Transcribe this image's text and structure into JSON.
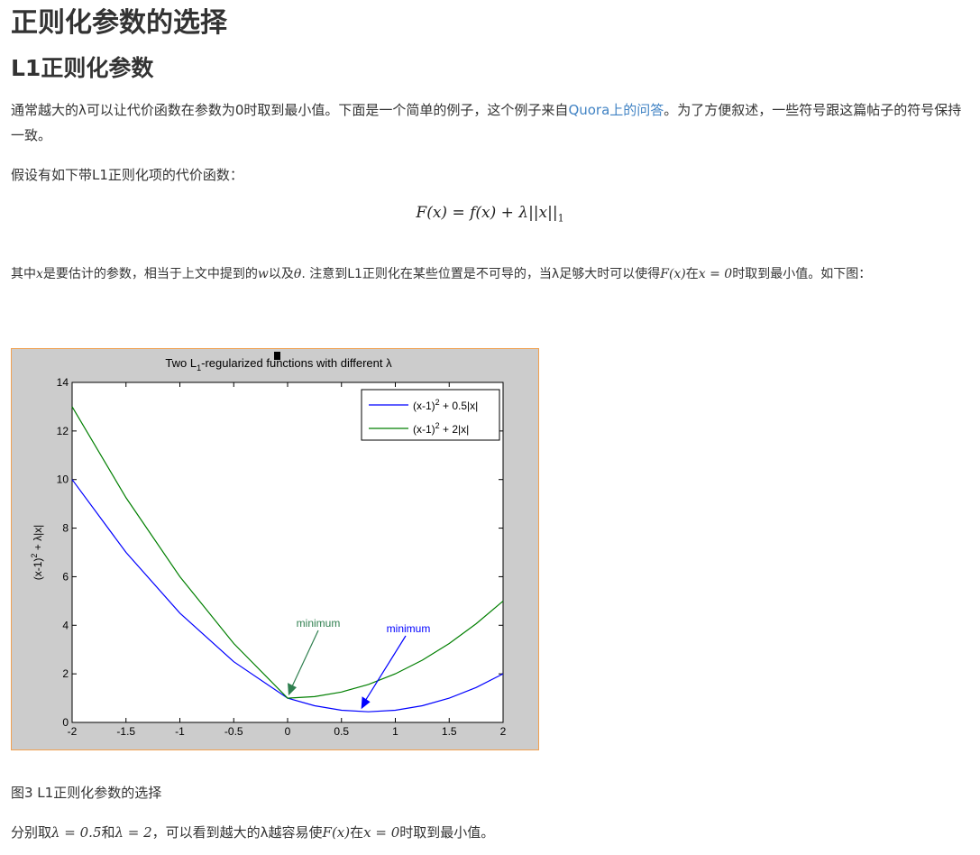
{
  "title": "正则化参数的选择",
  "subtitle": "L1正则化参数",
  "para1": {
    "pre": "通常越大的λ可以让代价函数在参数为0时取到最小值。下面是一个简单的例子，这个例子来自",
    "link": "Quora上的问答",
    "post": "。为了方便叙述，一些符号跟这篇帖子的符号保持一致。"
  },
  "para2": "假设有如下带L1正则化项的代价函数：",
  "formula": {
    "lhs": "F(x) = f(x) + λ||x||",
    "sub": "1"
  },
  "para3": {
    "t1": "其中",
    "v1": "x",
    "t2": "是要估计的参数，相当于上文中提到的",
    "v2": "w",
    "t3": "以及",
    "v3": "θ",
    "t4": ". 注意到L1正则化在某些位置是不可导的，当λ足够大时可以使得",
    "v4": "F(x)",
    "t5": "在",
    "v5": "x = 0",
    "t6": "时取到最小值。如下图："
  },
  "caption": "图3 L1正则化参数的选择",
  "last": {
    "t1": "分别取",
    "v1": "λ = 0.5",
    "t2": "和",
    "v2": "λ = 2",
    "t3": "，可以看到越大的λ越容易使",
    "v3": "F(x)",
    "t4": "在",
    "v4": "x = 0",
    "t5": "时取到最小值。"
  },
  "chart_data": {
    "type": "line",
    "title": "Two L1-regularized functions with different λ",
    "ylabel": "(x-1)2 + λ|x|",
    "xlabel": "",
    "xlim": [
      -2,
      2
    ],
    "ylim": [
      0,
      14
    ],
    "x_ticks": [
      "-2",
      "-1.5",
      "-1",
      "-0.5",
      "0",
      "0.5",
      "1",
      "1.5",
      "2"
    ],
    "y_ticks": [
      "0",
      "2",
      "4",
      "6",
      "8",
      "10",
      "12",
      "14"
    ],
    "legend_position": "top-right",
    "series": [
      {
        "name": "(x-1)2 + 0.5|x|",
        "color": "#0000ff",
        "x": [
          -2,
          -1.5,
          -1,
          -0.5,
          0,
          0.25,
          0.5,
          0.75,
          1,
          1.25,
          1.5,
          1.75,
          2
        ],
        "values": [
          10,
          7,
          4.5,
          2.5,
          1,
          0.6875,
          0.5,
          0.4375,
          0.5,
          0.6875,
          1,
          1.4375,
          2
        ]
      },
      {
        "name": "(x-1)2 + 2|x|",
        "color": "#007f00",
        "x": [
          -2,
          -1.5,
          -1,
          -0.5,
          0,
          0.25,
          0.5,
          0.75,
          1,
          1.25,
          1.5,
          1.75,
          2
        ],
        "values": [
          13,
          9.25,
          6,
          3.25,
          1,
          1.0625,
          1.25,
          1.5625,
          2,
          2.5625,
          3.25,
          4.0625,
          5
        ]
      }
    ],
    "annotations": [
      {
        "text": "minimum",
        "color": "#2f7f4f",
        "points_to": [
          0,
          1
        ]
      },
      {
        "text": "minimum",
        "color": "#0000ff",
        "points_to": [
          0.75,
          0.4375
        ]
      }
    ]
  }
}
